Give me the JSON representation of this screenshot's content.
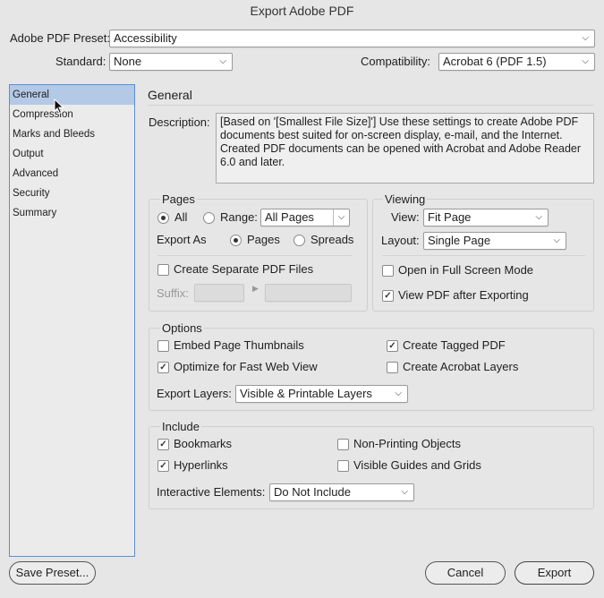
{
  "window": {
    "title": "Export Adobe PDF"
  },
  "top": {
    "preset_label": "Adobe PDF Preset:",
    "preset_value": "Accessibility",
    "standard_label": "Standard:",
    "standard_value": "None",
    "compat_label": "Compatibility:",
    "compat_value": "Acrobat 6 (PDF 1.5)"
  },
  "sidebar": {
    "items": [
      "General",
      "Compression",
      "Marks and Bleeds",
      "Output",
      "Advanced",
      "Security",
      "Summary"
    ],
    "selected": "General"
  },
  "general": {
    "heading": "General",
    "description_label": "Description:",
    "description": "[Based on '[Smallest File Size]'] Use these settings to create Adobe PDF documents best suited for on-screen display, e-mail, and the Internet.  Created PDF documents can be opened with Acrobat and Adobe Reader 6.0 and later."
  },
  "pages": {
    "title": "Pages",
    "all_label": "All",
    "range_label": "Range:",
    "range_value": "All Pages",
    "export_as_label": "Export As",
    "pages_label": "Pages",
    "spreads_label": "Spreads",
    "separate_label": "Create Separate PDF Files",
    "suffix_label": "Suffix:"
  },
  "viewing": {
    "title": "Viewing",
    "view_label": "View:",
    "view_value": "Fit Page",
    "layout_label": "Layout:",
    "layout_value": "Single Page",
    "fullscreen_label": "Open in Full Screen Mode",
    "view_after_label": "View PDF after Exporting"
  },
  "options": {
    "title": "Options",
    "thumbnails_label": "Embed Page Thumbnails",
    "fastweb_label": "Optimize for Fast Web View",
    "tagged_label": "Create Tagged PDF",
    "layers_label": "Create Acrobat Layers",
    "export_layers_label": "Export Layers:",
    "export_layers_value": "Visible & Printable Layers"
  },
  "include": {
    "title": "Include",
    "bookmarks_label": "Bookmarks",
    "hyperlinks_label": "Hyperlinks",
    "nonprinting_label": "Non-Printing Objects",
    "guides_label": "Visible Guides and Grids",
    "interactive_label": "Interactive Elements:",
    "interactive_value": "Do Not Include"
  },
  "buttons": {
    "save_preset": "Save Preset...",
    "cancel": "Cancel",
    "export": "Export"
  },
  "icons": {
    "chevron": "chevron-down-icon",
    "check": "checkmark-icon",
    "cursor": "cursor-pointer-icon"
  },
  "colors": {
    "selection": "#b3c9e6",
    "focus_border": "#5b8fd8"
  }
}
